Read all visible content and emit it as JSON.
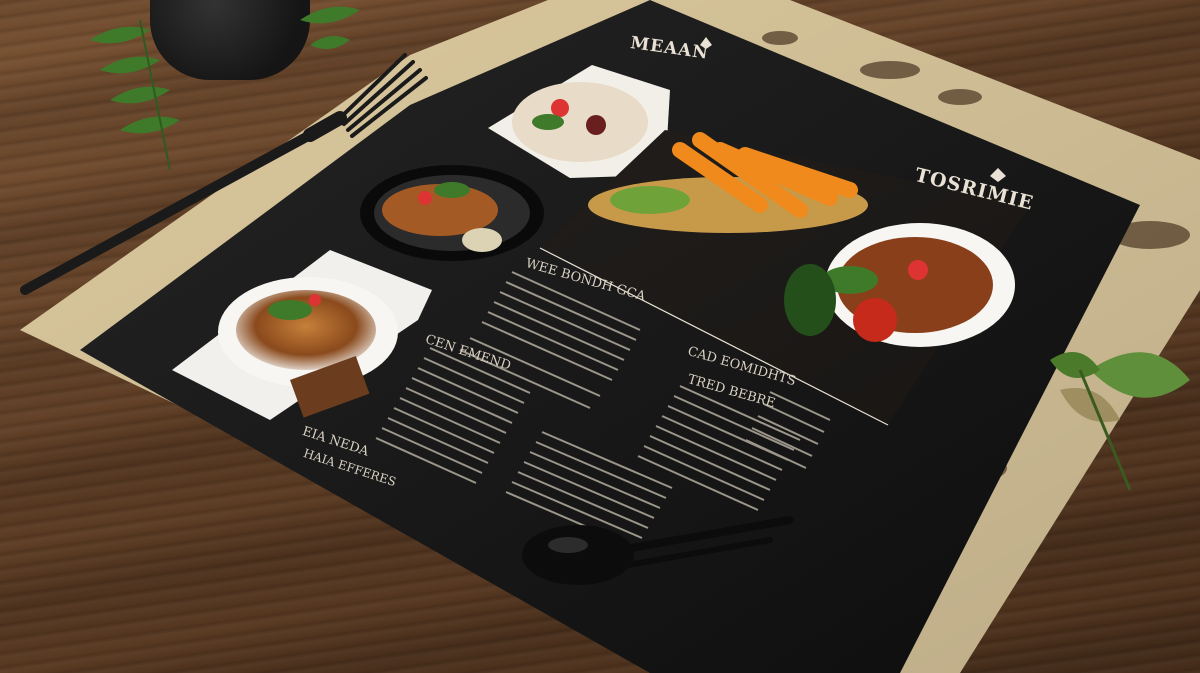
{
  "menu": {
    "brand": "MEAAN",
    "title": "TOSRIMIE",
    "headings": [
      "WEE BONDH GCA",
      "CEN EMEND",
      "CAD EOMIDHTS",
      "TRED BEBRE",
      "EIA NEDA",
      "HAIA EFFERES"
    ]
  },
  "colors": {
    "card": "#141414",
    "placemat": "#e7d3a6",
    "table": "#5e3d24",
    "text": "#e9e1d3"
  },
  "icons": [
    "fork-icon",
    "spoon-icon",
    "plant-icon",
    "leaf-icon"
  ]
}
